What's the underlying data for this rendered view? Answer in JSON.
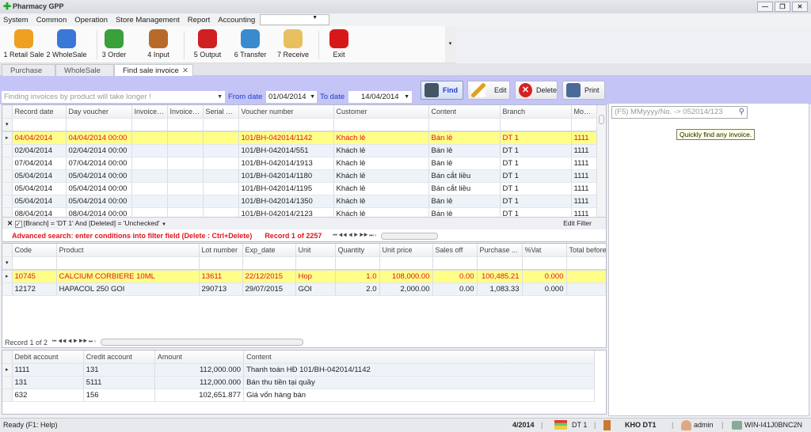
{
  "app": {
    "title": "Pharmacy GPP"
  },
  "menu": [
    "System",
    "Common",
    "Operation",
    "Store Management",
    "Report",
    "Accounting"
  ],
  "toolbar": [
    {
      "label": "1 Retail Sale",
      "icon": "pill-icon",
      "color": "#f0a020"
    },
    {
      "label": "2 WholeSale",
      "icon": "pills-icon",
      "color": "#3a78d8"
    },
    {
      "label": "3 Order",
      "icon": "phone-icon",
      "color": "#3aa03a"
    },
    {
      "label": "4 Input",
      "icon": "door-in-icon",
      "color": "#b86a2a"
    },
    {
      "label": "5 Output",
      "icon": "door-out-icon",
      "color": "#d02020"
    },
    {
      "label": "6 Transfer",
      "icon": "transfer-icon",
      "color": "#3a8ad0"
    },
    {
      "label": "7 Receive",
      "icon": "clipboard-icon",
      "color": "#e8c060"
    },
    {
      "label": "Exit",
      "icon": "power-icon",
      "color": "#d81818"
    }
  ],
  "tabs": [
    {
      "label": "Purchase"
    },
    {
      "label": "WholeSale"
    },
    {
      "label": "Find sale invoice",
      "active": true
    }
  ],
  "actions": {
    "find": "Find",
    "edit": "Edit",
    "delete": "Delete",
    "print": "Print"
  },
  "filter": {
    "product_placeholder": "Finding invoices by product will take longer !",
    "from_label": "From date",
    "from_value": "01/04/2014",
    "to_label": "To date",
    "to_value": "14/04/2014"
  },
  "quick_search": {
    "placeholder": "(F5) MMyyyy/No. -> 052014/123",
    "tooltip": "Quickly find any invoice."
  },
  "invoices": {
    "columns": [
      "Record date",
      "Day voucher",
      "Invoice ...",
      "Invoice ...",
      "Serial nu...",
      "Voucher number",
      "Customer",
      "Content",
      "Branch",
      "Mode ..."
    ],
    "rows": [
      [
        "04/04/2014",
        "04/04/2014 00:00",
        "",
        "",
        "",
        "101/BH-042014/1142",
        "Khách lẻ",
        "Bán lẻ",
        "DT 1",
        "1111"
      ],
      [
        "02/04/2014",
        "02/04/2014 00:00",
        "",
        "",
        "",
        "101/BH-042014/551",
        "Khách lẻ",
        "Bán lẻ",
        "DT 1",
        "1111"
      ],
      [
        "07/04/2014",
        "07/04/2014 00:00",
        "",
        "",
        "",
        "101/BH-042014/1913",
        "Khách lẻ",
        "Bán lẻ",
        "DT 1",
        "1111"
      ],
      [
        "05/04/2014",
        "05/04/2014 00:00",
        "",
        "",
        "",
        "101/BH-042014/1180",
        "Khách lẻ",
        "Bán cắt liều",
        "DT 1",
        "1111"
      ],
      [
        "05/04/2014",
        "05/04/2014 00:00",
        "",
        "",
        "",
        "101/BH-042014/1195",
        "Khách lẻ",
        "Bán cắt liều",
        "DT 1",
        "1111"
      ],
      [
        "05/04/2014",
        "05/04/2014 00:00",
        "",
        "",
        "",
        "101/BH-042014/1350",
        "Khách lẻ",
        "Bán lẻ",
        "DT 1",
        "1111"
      ],
      [
        "08/04/2014",
        "08/04/2014 00:00",
        "",
        "",
        "",
        "101/BH-042014/2123",
        "Khách lẻ",
        "Bán lẻ",
        "DT 1",
        "1111"
      ]
    ],
    "filter_expression": "[Branch] = 'DT 1' And [Deleted] = 'Unchecked'",
    "edit_filter": "Edit Filter",
    "advanced_hint": "Advanced search: enter conditions into filter field (Delete : Ctrl+Delete)",
    "record_info": "Record 1 of 2257"
  },
  "details": {
    "columns": [
      "Code",
      "Product",
      "Lot number",
      "Exp_date",
      "Unit",
      "Quantity",
      "Unit price",
      "Sales off",
      "Purchase ...",
      "%Vat",
      "Total before"
    ],
    "rows": [
      [
        "10745",
        "CALCIUM CORBIERE 10ML",
        "13611",
        "22/12/2015",
        "Hop",
        "1.0",
        "108,000.00",
        "0.00",
        "100,485.21",
        "0.000",
        ""
      ],
      [
        "12172",
        "HAPACOL 250 GOI",
        "290713",
        "29/07/2015",
        "GOI",
        "2.0",
        "2,000.00",
        "0.00",
        "1,083.33",
        "0.000",
        ""
      ]
    ],
    "record_info": "Record 1 of 2"
  },
  "accounts": {
    "columns": [
      "Debit account",
      "Credit account",
      "Amount",
      "Content"
    ],
    "rows": [
      [
        "1111",
        "131",
        "112,000.000",
        "Thanh toán HĐ 101/BH-042014/1142"
      ],
      [
        "131",
        "5111",
        "112,000.000",
        "Bán thu tiền tại quầy"
      ],
      [
        "632",
        "156",
        "102,651.877",
        "Giá vốn hàng bán"
      ]
    ]
  },
  "status": {
    "ready": "Ready (F1: Help)",
    "period": "4/2014",
    "branch": "DT 1",
    "store": "KHO DT1",
    "user": "admin",
    "machine": "WIN-I41J0BNC2N"
  }
}
